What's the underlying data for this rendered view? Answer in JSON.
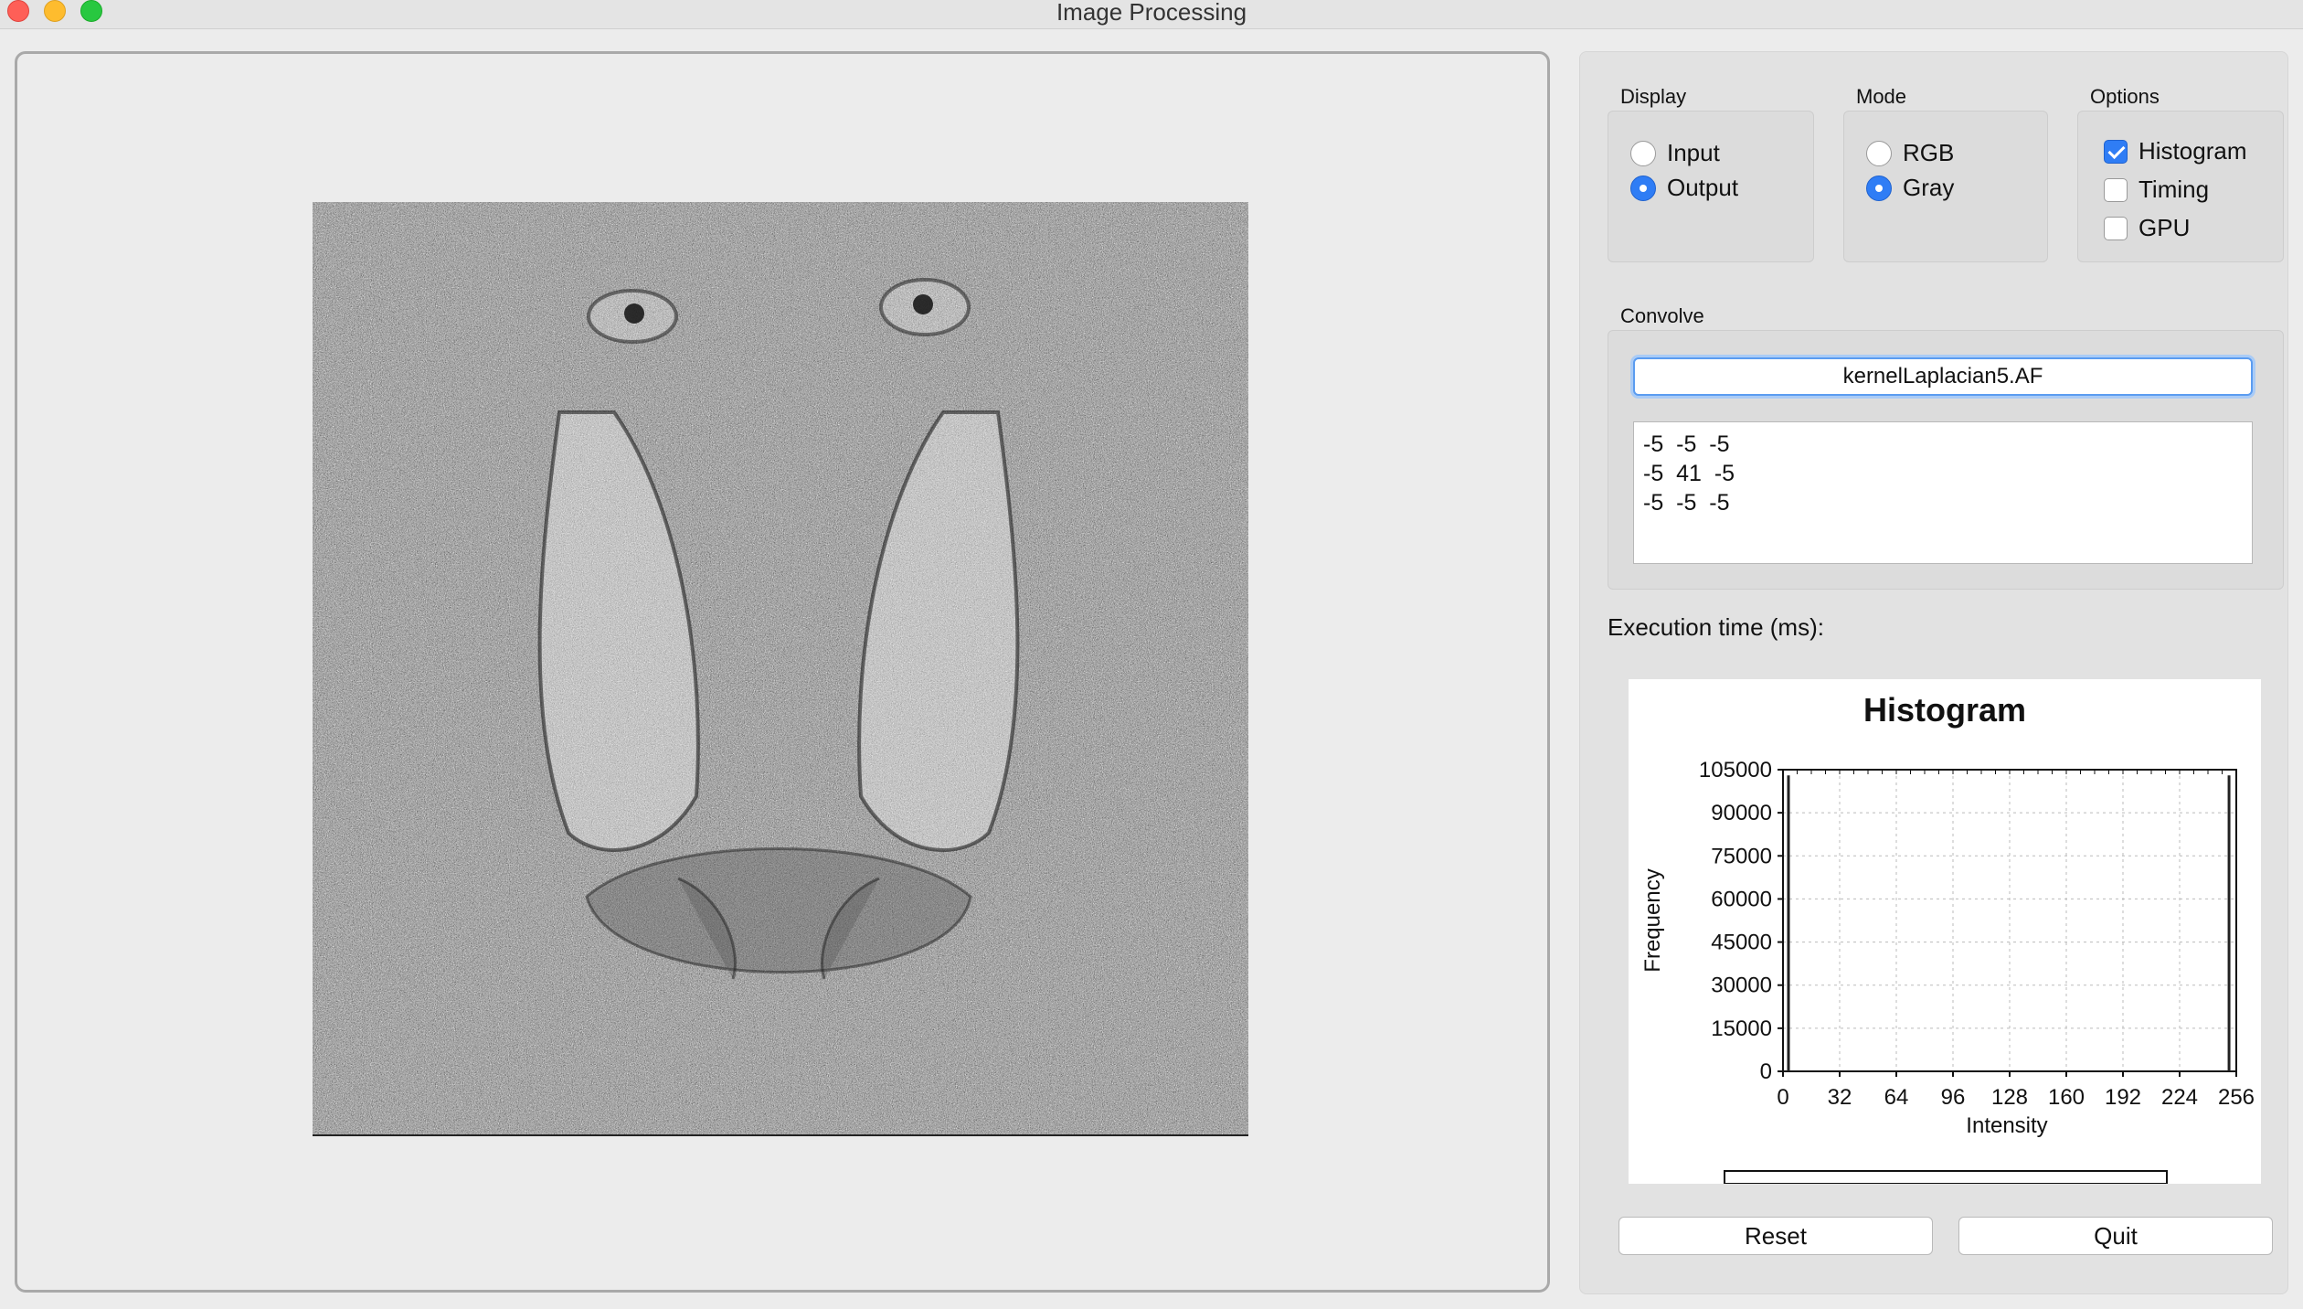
{
  "window": {
    "title": "Image Processing"
  },
  "display": {
    "title": "Display",
    "options": [
      "Input",
      "Output"
    ],
    "selected": "Output"
  },
  "mode": {
    "title": "Mode",
    "options": [
      "RGB",
      "Gray"
    ],
    "selected": "Gray"
  },
  "options": {
    "title": "Options",
    "items": [
      {
        "label": "Histogram",
        "checked": true
      },
      {
        "label": "Timing",
        "checked": false
      },
      {
        "label": "GPU",
        "checked": false
      }
    ]
  },
  "convolve": {
    "title": "Convolve",
    "kernel_file": "kernelLaplacian5.AF",
    "kernel_rows": [
      "-5  -5  -5",
      "-5  41  -5",
      "-5  -5  -5"
    ]
  },
  "execution_time_label": "Execution time (ms):",
  "histogram": {
    "title": "Histogram",
    "xlabel": "Intensity",
    "ylabel": "Frequency",
    "x_ticks": [
      "0",
      "32",
      "64",
      "96",
      "128",
      "160",
      "192",
      "224",
      "256"
    ],
    "y_ticks": [
      "0",
      "15000",
      "30000",
      "45000",
      "60000",
      "75000",
      "90000",
      "105000"
    ],
    "xlim": [
      0,
      256
    ],
    "ylim": [
      0,
      105000
    ],
    "spikes": [
      {
        "x": 0,
        "y": 103000
      },
      {
        "x": 255,
        "y": 103000
      }
    ]
  },
  "buttons": {
    "reset": "Reset",
    "quit": "Quit"
  },
  "colors": {
    "accent": "#2f7df5",
    "focus_ring": "#5b9cf0"
  }
}
